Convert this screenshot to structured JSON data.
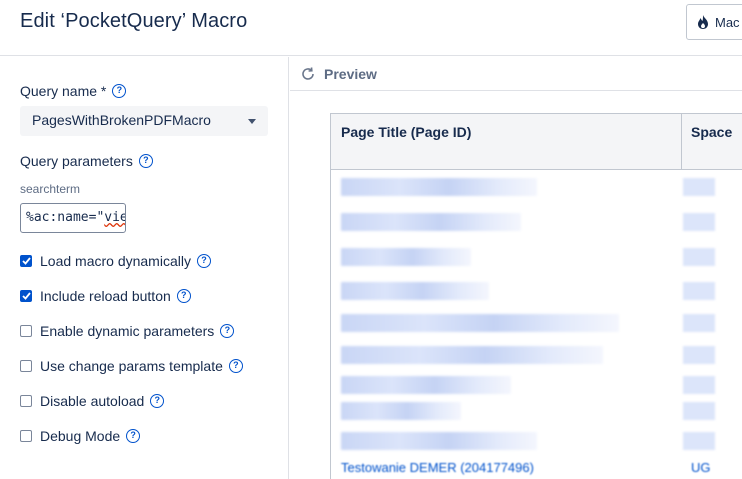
{
  "header": {
    "title": "Edit ‘PocketQuery’ Macro",
    "macro_button_label": "Mac"
  },
  "form": {
    "query_name_label": "Query name *",
    "query_name_value": "PagesWithBrokenPDFMacro",
    "query_params_label": "Query parameters",
    "param_name": "searchterm",
    "param_value_prefix": "%ac:name=\"",
    "param_value_misspelled": "vie",
    "options": [
      {
        "label": "Load macro dynamically",
        "checked": true
      },
      {
        "label": "Include reload button",
        "checked": true
      },
      {
        "label": "Enable dynamic parameters",
        "checked": false
      },
      {
        "label": "Use change params template",
        "checked": false
      },
      {
        "label": "Disable autoload",
        "checked": false
      },
      {
        "label": "Debug Mode",
        "checked": false
      }
    ]
  },
  "preview": {
    "label": "Preview",
    "columns": [
      "Page Title (Page ID)",
      "Space"
    ],
    "last_row_title": "Testowanie DEMER (204177496)",
    "last_row_space": "UG"
  },
  "colors": {
    "accent": "#0052cc",
    "text": "#172b4d",
    "muted": "#5e6c84",
    "border": "#dfe1e6"
  }
}
